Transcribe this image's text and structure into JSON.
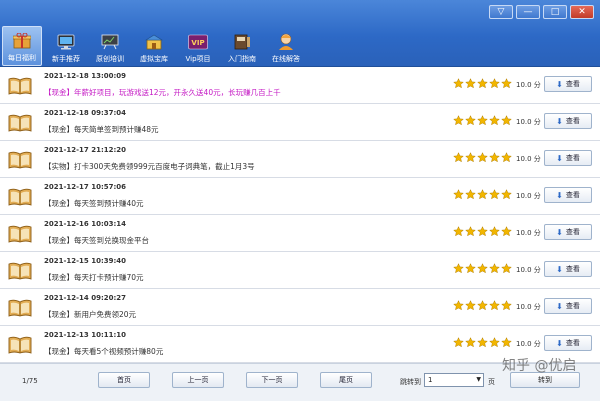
{
  "toolbar": {
    "items": [
      {
        "label": "每日福利",
        "icon": "gift-box-icon",
        "active": true
      },
      {
        "label": "新手推荐",
        "icon": "monitor-icon",
        "active": false
      },
      {
        "label": "原创培训",
        "icon": "presentation-board-icon",
        "active": false
      },
      {
        "label": "虚拟宝库",
        "icon": "treasure-store-icon",
        "active": false
      },
      {
        "label": "Vip项目",
        "icon": "vip-badge-icon",
        "badge": "VIP",
        "active": false
      },
      {
        "label": "入门指南",
        "icon": "guide-book-icon",
        "active": false
      },
      {
        "label": "在线解答",
        "icon": "support-person-icon",
        "active": false
      }
    ],
    "window_buttons": [
      "▽",
      "—",
      "□",
      "✕"
    ]
  },
  "list": {
    "rows": [
      {
        "date": "2021-12-18 13:00:09",
        "text": "【现金】年薪好项目，玩游戏送12元，开永久送40元，长玩赚几百上千",
        "highlight": true,
        "score": "10.0 分",
        "view": "查看"
      },
      {
        "date": "2021-12-18 09:37:04",
        "text": "【现金】每天简单签到预计赚48元",
        "highlight": false,
        "score": "10.0 分",
        "view": "查看"
      },
      {
        "date": "2021-12-17 21:12:20",
        "text": "【实物】打卡300天免费领999元百度电子词典笔，截止1月3号",
        "highlight": false,
        "score": "10.0 分",
        "view": "查看"
      },
      {
        "date": "2021-12-17 10:57:06",
        "text": "【现金】每天签到预计赚40元",
        "highlight": false,
        "score": "10.0 分",
        "view": "查看"
      },
      {
        "date": "2021-12-16 10:03:14",
        "text": "【现金】每天签到兑换现金平台",
        "highlight": false,
        "score": "10.0 分",
        "view": "查看"
      },
      {
        "date": "2021-12-15 10:39:40",
        "text": "【现金】每天打卡预计赚70元",
        "highlight": false,
        "score": "10.0 分",
        "view": "查看"
      },
      {
        "date": "2021-12-14 09:20:27",
        "text": "【现金】新用户免费领20元",
        "highlight": false,
        "score": "10.0 分",
        "view": "查看"
      },
      {
        "date": "2021-12-13 10:11:10",
        "text": "【现金】每天看5个视频预计赚80元",
        "highlight": false,
        "score": "10.0 分",
        "view": "查看"
      }
    ]
  },
  "footer": {
    "page_info": "1/75",
    "first": "首页",
    "prev": "上一页",
    "next": "下一页",
    "last": "尾页",
    "jump_label": "跳转到",
    "jump_value": "1",
    "page_unit": "页",
    "go": "转到"
  },
  "watermark": "知乎 @优启",
  "colors": {
    "toolbar_blue": "#2d69c6",
    "highlight_text": "#c418c4",
    "star": "#f2b600"
  }
}
